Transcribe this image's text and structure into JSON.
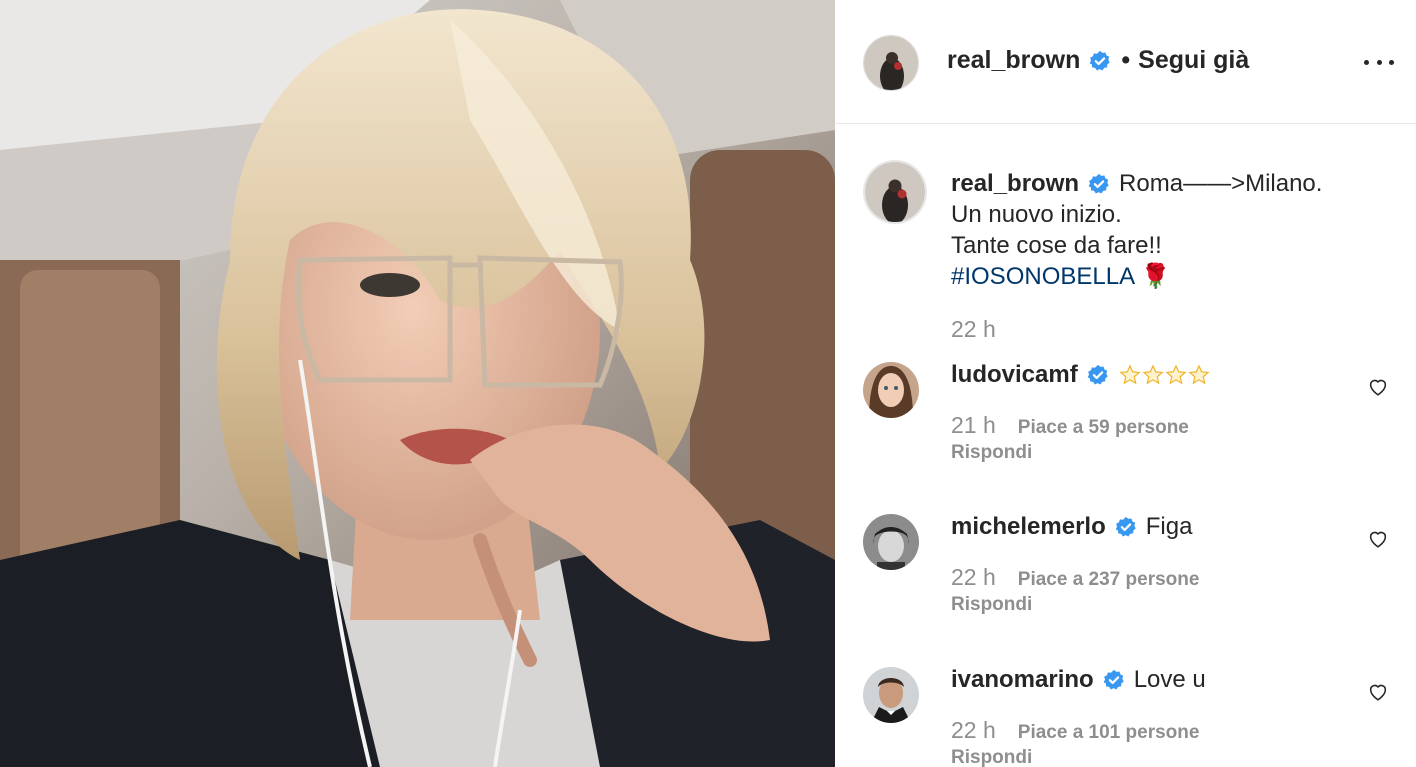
{
  "post": {
    "author": "real_brown",
    "follow_status": "Segui già",
    "separator": "•",
    "photo_alt": "selfie"
  },
  "caption": {
    "author": "real_brown",
    "line1": "Roma——>Milano.",
    "line2": "Un nuovo inizio.",
    "line3": "Tante cose da fare!!",
    "hashtag": "#IOSONOBELLA",
    "emoji": "🌹",
    "time": "22 h"
  },
  "comments": [
    {
      "user": "ludovicamf",
      "text": "",
      "stars": 4,
      "time": "21 h",
      "likes": "Piace a 59 persone",
      "reply": "Rispondi"
    },
    {
      "user": "michelemerlo",
      "text": "Figa",
      "time": "22 h",
      "likes": "Piace a 237 persone",
      "reply": "Rispondi"
    },
    {
      "user": "ivanomarino",
      "text": "Love u",
      "time": "22 h",
      "likes": "Piace a 101 persone",
      "reply": "Rispondi"
    }
  ],
  "icons": {
    "verified": "verified-badge-icon",
    "more": "more-options-icon",
    "like": "heart-outline-icon",
    "star": "star-emoji-icon"
  },
  "colors": {
    "verified_blue": "#3897f0",
    "hashtag": "#00376b",
    "secondary_text": "#8e8e8e",
    "primary_text": "#262626"
  }
}
